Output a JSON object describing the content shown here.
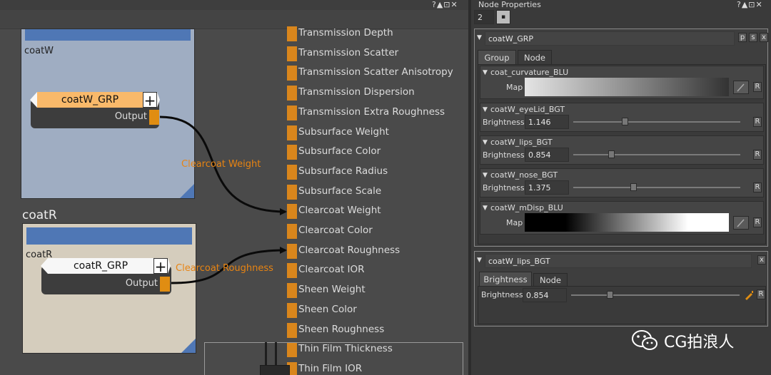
{
  "panel": {
    "title": "Node Properties",
    "max_count": "2",
    "window_icons": "?▲⊡✕"
  },
  "graph": {
    "window_icons": "?▲⊡✕",
    "backdrops": {
      "coatW": {
        "label": "coatW"
      },
      "coatR": {
        "title": "coatR",
        "label": "coatR"
      }
    },
    "nodes": {
      "coatW_GRP": {
        "name": "coatW_GRP",
        "output": "Output"
      },
      "coatR_GRP": {
        "name": "coatR_GRP",
        "output": "Output"
      }
    },
    "connection_labels": {
      "weight": "Clearcoat Weight",
      "roughness": "Clearcoat Roughness"
    },
    "shader_params": [
      "Transmission Depth",
      "Transmission Scatter",
      "Transmission Scatter Anisotropy",
      "Transmission Dispersion",
      "Transmission Extra Roughness",
      "Subsurface Weight",
      "Subsurface Color",
      "Subsurface Radius",
      "Subsurface Scale",
      "Clearcoat Weight",
      "Clearcoat Color",
      "Clearcoat Roughness",
      "Clearcoat IOR",
      "Sheen Weight",
      "Sheen Color",
      "Sheen Roughness",
      "Thin Film Thickness",
      "Thin Film IOR"
    ]
  },
  "props": {
    "group_panel": {
      "title": "coatW_GRP",
      "buttons": [
        "p",
        "s",
        "x"
      ],
      "tabs": [
        "Group",
        "Node"
      ],
      "sections": [
        {
          "name": "coat_curvature_BLU",
          "param": "Map",
          "kind": "ramp",
          "ramp": "mid"
        },
        {
          "name": "coatW_eyeLid_BGT",
          "param": "Brightness",
          "value": "1.146",
          "fraction": 0.29
        },
        {
          "name": "coatW_lips_BGT",
          "param": "Brightness",
          "value": "0.854",
          "fraction": 0.21
        },
        {
          "name": "coatW_nose_BGT",
          "param": "Brightness",
          "value": "1.375",
          "fraction": 0.34
        },
        {
          "name": "coatW_mDisp_BLU",
          "param": "Map",
          "kind": "ramp",
          "ramp": "dark"
        }
      ],
      "reset_label": "R"
    },
    "lips_panel": {
      "title": "coatW_lips_BGT",
      "close": "x",
      "tabs": [
        "Brightness",
        "Node"
      ],
      "param": "Brightness",
      "value": "0.854",
      "fraction": 0.21,
      "reset_label": "R"
    }
  },
  "watermark": {
    "text": "CG拍浪人"
  }
}
